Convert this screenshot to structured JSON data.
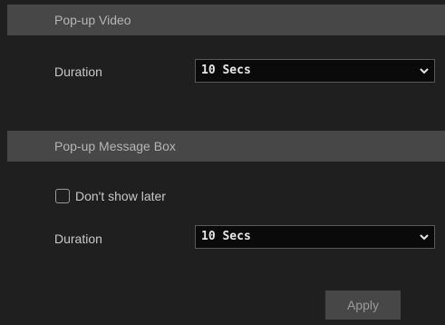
{
  "popup_video": {
    "header": "Pop-up Video",
    "duration_label": "Duration",
    "duration_value": "10 Secs"
  },
  "popup_message_box": {
    "header": "Pop-up Message Box",
    "dont_show_later_label": "Don't show later",
    "dont_show_later_checked": false,
    "duration_label": "Duration",
    "duration_value": "10 Secs"
  },
  "apply_label": "Apply",
  "colors": {
    "background": "#1f1f1f",
    "header_bar": "#474747",
    "select_background": "#0a0a0a"
  },
  "icons": {
    "dropdown": "chevron-down-icon",
    "checkbox": "checkbox-unchecked-icon"
  }
}
